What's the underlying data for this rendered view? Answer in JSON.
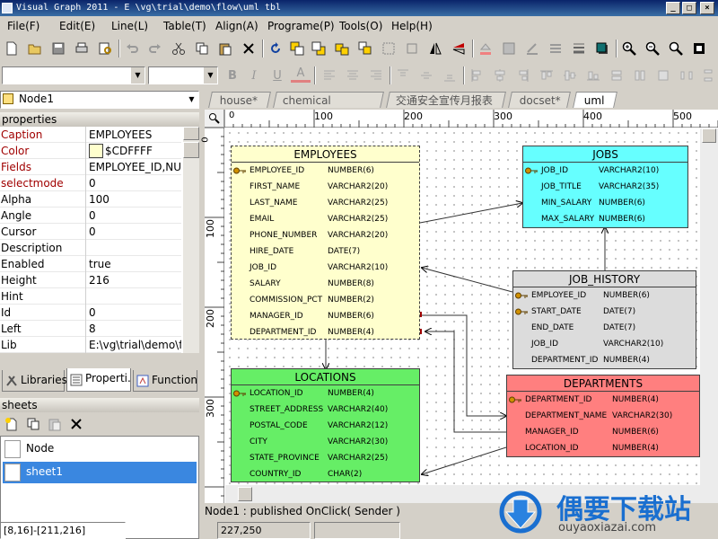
{
  "window": {
    "title": "Visual Graph 2011 - E \\vg\\trial\\demo\\flow\\uml tbl",
    "min": "_",
    "max": "□",
    "close": "×"
  },
  "menu": [
    "File(F)",
    "Edit(E)",
    "Line(L)",
    "Table(T)",
    "Align(A)",
    "Programe(P)",
    "Tools(O)",
    "Help(H)"
  ],
  "node_selector": {
    "value": "Node1"
  },
  "properties": {
    "header": "properties",
    "rows": [
      {
        "k": "Caption",
        "v": "EMPLOYEES"
      },
      {
        "k": "Color",
        "v": "$CDFFFF"
      },
      {
        "k": "Fields",
        "v": "EMPLOYEE_ID,NU"
      },
      {
        "k": "selectmode",
        "v": "0"
      },
      {
        "k": "Alpha",
        "v": "100"
      },
      {
        "k": "Angle",
        "v": "0"
      },
      {
        "k": "Cursor",
        "v": "0"
      },
      {
        "k": "Description",
        "v": ""
      },
      {
        "k": "Enabled",
        "v": "true"
      },
      {
        "k": "Height",
        "v": "216"
      },
      {
        "k": "Hint",
        "v": ""
      },
      {
        "k": "Id",
        "v": "0"
      },
      {
        "k": "Left",
        "v": "8"
      },
      {
        "k": "Lib",
        "v": "E:\\vg\\trial\\demo\\flow"
      }
    ],
    "color_swatch": "#FFFFCD"
  },
  "panel_tabs": [
    "Libraries",
    "Properti.",
    "Function"
  ],
  "sheets": {
    "header": "sheets",
    "items": [
      "Node",
      "sheet1"
    ],
    "selected": "sheet1"
  },
  "doc_tabs": [
    "house*",
    "chemical industry*",
    "交通安全宣传月报表*",
    "docset*",
    "uml"
  ],
  "ruler": {
    "h": [
      "100",
      "200",
      "300",
      "400",
      "500"
    ],
    "v": [
      "100",
      "200",
      "300"
    ],
    "h_zero": "0",
    "v_zero": "0"
  },
  "entities": {
    "employees": {
      "title": "EMPLOYEES",
      "color": "#FFFFCD",
      "fields": [
        [
          "EMPLOYEE_ID",
          "NUMBER(6)",
          true
        ],
        [
          "FIRST_NAME",
          "VARCHAR2(20)",
          false
        ],
        [
          "LAST_NAME",
          "VARCHAR2(25)",
          false
        ],
        [
          "EMAIL",
          "VARCHAR2(25)",
          false
        ],
        [
          "PHONE_NUMBER",
          "VARCHAR2(20)",
          false
        ],
        [
          "HIRE_DATE",
          "DATE(7)",
          false
        ],
        [
          "JOB_ID",
          "VARCHAR2(10)",
          false
        ],
        [
          "SALARY",
          "NUMBER(8)",
          false
        ],
        [
          "COMMISSION_PCT",
          "NUMBER(2)",
          false
        ],
        [
          "MANAGER_ID",
          "NUMBER(6)",
          false
        ],
        [
          "DEPARTMENT_ID",
          "NUMBER(4)",
          false
        ]
      ]
    },
    "jobs": {
      "title": "JOBS",
      "color": "#66FFFF",
      "fields": [
        [
          "JOB_ID",
          "VARCHAR2(10)",
          true
        ],
        [
          "JOB_TITLE",
          "VARCHAR2(35)",
          false
        ],
        [
          "MIN_SALARY",
          "NUMBER(6)",
          false
        ],
        [
          "MAX_SALARY",
          "NUMBER(6)",
          false
        ]
      ]
    },
    "job_history": {
      "title": "JOB_HISTORY",
      "color": "#DCDCDC",
      "fields": [
        [
          "EMPLOYEE_ID",
          "NUMBER(6)",
          true
        ],
        [
          "START_DATE",
          "DATE(7)",
          true
        ],
        [
          "END_DATE",
          "DATE(7)",
          false
        ],
        [
          "JOB_ID",
          "VARCHAR2(10)",
          false
        ],
        [
          "DEPARTMENT_ID",
          "NUMBER(4)",
          false
        ]
      ]
    },
    "locations": {
      "title": "LOCATIONS",
      "color": "#66EE66",
      "fields": [
        [
          "LOCATION_ID",
          "NUMBER(4)",
          true
        ],
        [
          "STREET_ADDRESS",
          "VARCHAR2(40)",
          false
        ],
        [
          "POSTAL_CODE",
          "VARCHAR2(12)",
          false
        ],
        [
          "CITY",
          "VARCHAR2(30)",
          false
        ],
        [
          "STATE_PROVINCE",
          "VARCHAR2(25)",
          false
        ],
        [
          "COUNTRY_ID",
          "CHAR(2)",
          false
        ]
      ]
    },
    "departments": {
      "title": "DEPARTMENTS",
      "color": "#FF7F7F",
      "fields": [
        [
          "DEPARTMENT_ID",
          "NUMBER(4)",
          true
        ],
        [
          "DEPARTMENT_NAME",
          "VARCHAR2(30)",
          false
        ],
        [
          "MANAGER_ID",
          "NUMBER(6)",
          false
        ],
        [
          "LOCATION_ID",
          "NUMBER(4)",
          false
        ]
      ]
    }
  },
  "event_line": "Node1 : published OnClick( Sender )",
  "status": {
    "sel": "[8,16]-[211,216]",
    "pos": "227,250"
  },
  "watermark": {
    "cn": "偶要下载站",
    "url": "ouyaoxiazai.com"
  }
}
